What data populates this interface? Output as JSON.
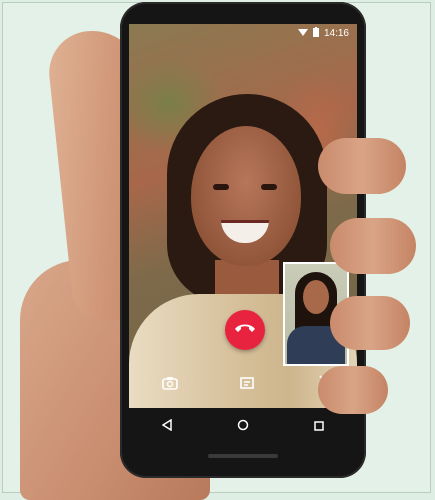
{
  "status_bar": {
    "time": "14:16",
    "icons": [
      "wifi-icon",
      "battery-icon"
    ]
  },
  "call": {
    "type": "video-call",
    "controls": [
      {
        "name": "switch-camera-icon"
      },
      {
        "name": "end-call-icon",
        "color": "#e8233f"
      },
      {
        "name": "video-toggle-icon"
      },
      {
        "name": "mute-icon"
      }
    ]
  },
  "navigation": {
    "buttons": [
      "back-icon",
      "home-icon",
      "recents-icon"
    ]
  },
  "colors": {
    "end_call": "#e8233f",
    "background": "#dfeee4"
  }
}
